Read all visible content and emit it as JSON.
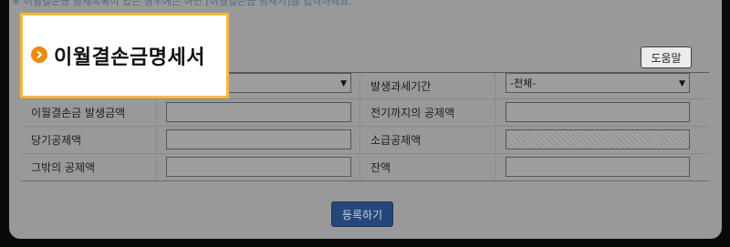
{
  "notice": "※ 이월결손금 명세목록이 있는 경우에는 하단 [이월결손금 명세서]를 입력하세요.",
  "title": "이월결손금명세서",
  "help_button": "도움말",
  "form": {
    "row1": {
      "select1_value": "",
      "label2": "발생과세기간",
      "select2_value": "-전체-"
    },
    "row2": {
      "label1": "이월결손금 발생금액",
      "label2": "전기까지의 공제액"
    },
    "row3": {
      "label1": "당기공제액",
      "label2": "소급공제액"
    },
    "row4": {
      "label1": "그밖의 공제액",
      "label2": "잔액"
    }
  },
  "submit_button": "등록하기"
}
